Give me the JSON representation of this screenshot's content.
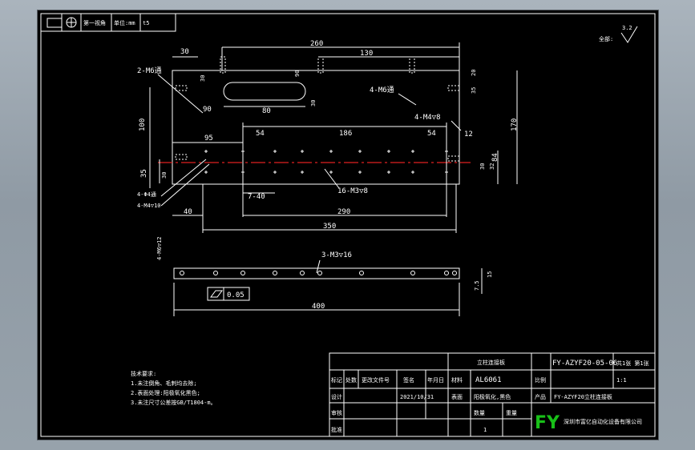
{
  "header_strip": {
    "scale_label": "比例:1:1",
    "projection_label": "第一视角",
    "unit_label": "单位:mm",
    "thickness_label": "t5"
  },
  "roughness": {
    "value": "3.2",
    "prefix": "全部:"
  },
  "top_view": {
    "dims": {
      "total_len": "260",
      "right_len": "130",
      "left_offset": "30",
      "slot_len": "80",
      "hole_90": "90",
      "slot_pitch_30": "30",
      "slot_pitch_90": "90",
      "slot_h": "30",
      "h_100": "100",
      "h_35": "35",
      "h_30": "30",
      "pitch_95": "95",
      "pitch_54a": "54",
      "pitch_186": "186",
      "pitch_54b": "54",
      "r12": "12",
      "h_170": "170",
      "h_84": "84",
      "h_30b": "30",
      "h_32": "32",
      "h_20": "20",
      "h_35b": "35",
      "w_7_40": "7-40",
      "w_40": "40",
      "w_290": "290",
      "w_350": "350"
    },
    "callouts": {
      "c_m6": "2-M6通",
      "c_m6b": "4-M6通",
      "c_m4": "4-M4▽8",
      "c_phi4": "4-Φ4通",
      "c_m4b": "4-M4▽10",
      "c_m3": "16-M3▽8"
    }
  },
  "side_view": {
    "dims": {
      "len_400": "400",
      "h_7_5": "7.5",
      "h_15": "15"
    },
    "callouts": {
      "c_m6": "4-M6▽12",
      "c_m3": "3-M3▽16"
    },
    "flatness_value": "0.05"
  },
  "tech_requirements": {
    "title": "技术要求:",
    "items": [
      "1.未注倒角、毛刺均去除;",
      "2.表面处理:阳极氧化黑色;",
      "3.未注尺寸公差按GB/T1804-m。"
    ]
  },
  "title_block": {
    "drawing_no": "FY-AZYF20-05-06",
    "material_label": "材料",
    "material": "AL6061",
    "part_name": "立柱连接板",
    "surface_label": "表面",
    "surface": "阳极氧化,黑色",
    "date": "2021/10/31",
    "qty_label": "数量",
    "qty": "1",
    "weight_label": "重量",
    "scale_label": "比例",
    "scale_val": "1:1",
    "product_label": "产品",
    "product": "FY-AZYF20立柱连接板",
    "logo": "FY",
    "company": "深圳市富亿自动化设备有限公司",
    "design_label": "设计",
    "check_label": "审核",
    "approve_label": "批准",
    "marks": [
      "标记",
      "处数",
      "更改文件号",
      "签名",
      "年月日"
    ],
    "sheet_info": "共1张 第1张"
  }
}
